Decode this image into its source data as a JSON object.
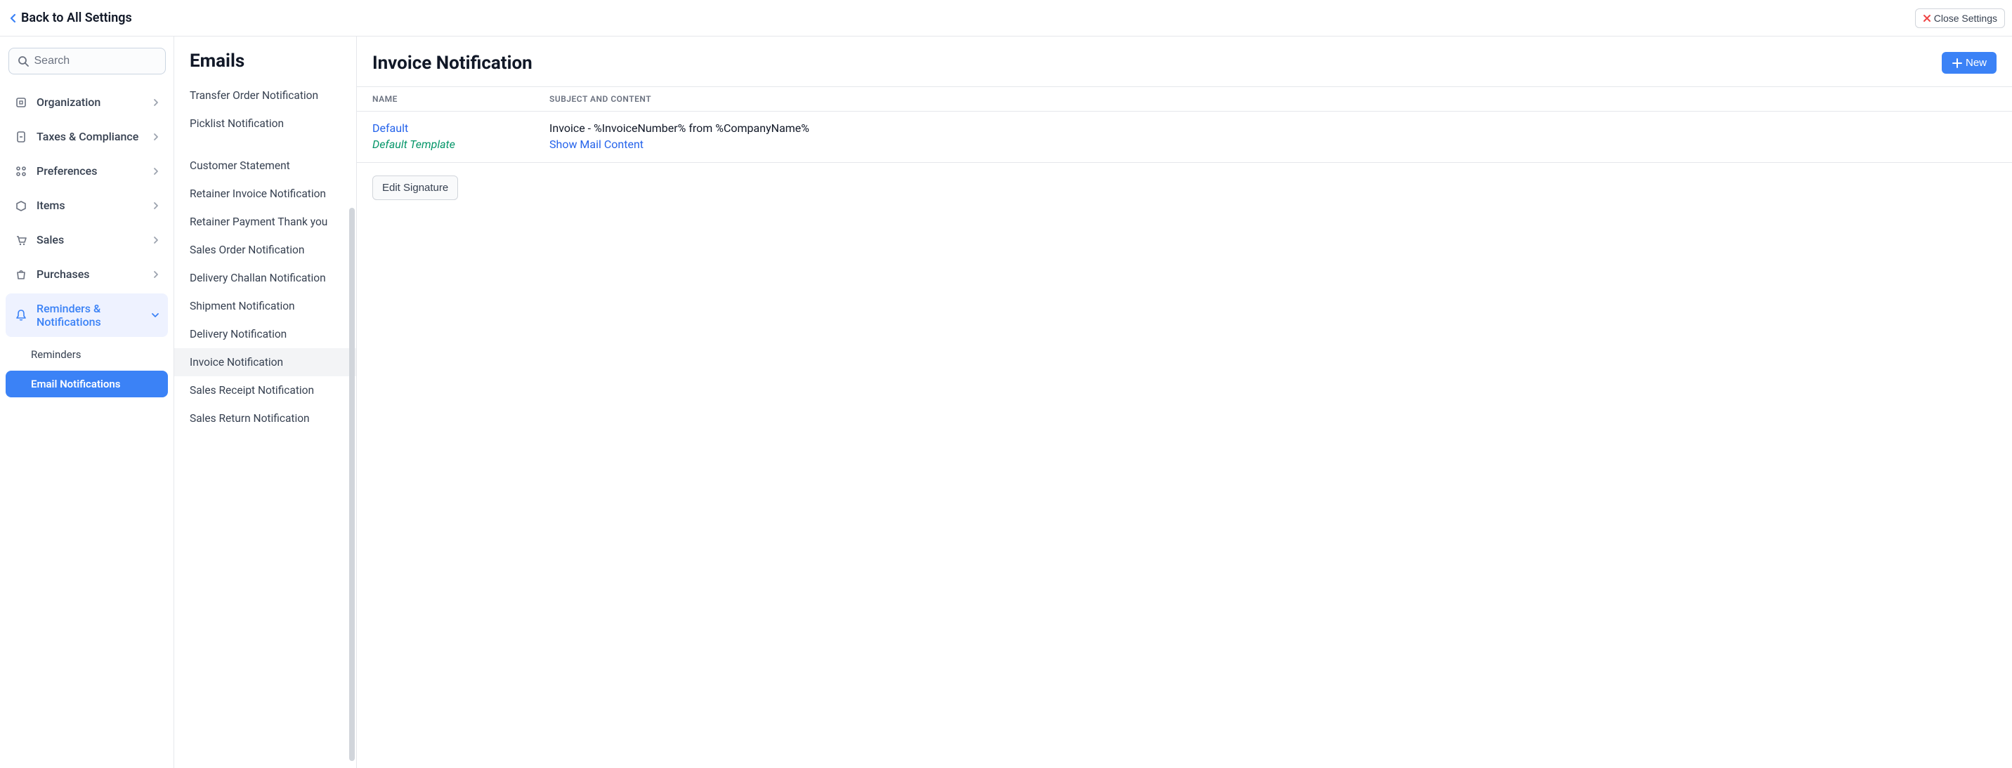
{
  "topbar": {
    "back_label": "Back to All Settings",
    "close_label": "Close Settings"
  },
  "search": {
    "placeholder": "Search"
  },
  "sidebar": {
    "items": [
      {
        "label": "Organization",
        "expandable": true
      },
      {
        "label": "Taxes & Compliance",
        "expandable": true
      },
      {
        "label": "Preferences",
        "expandable": true
      },
      {
        "label": "Items",
        "expandable": true
      },
      {
        "label": "Sales",
        "expandable": true
      },
      {
        "label": "Purchases",
        "expandable": true
      },
      {
        "label": "Reminders & Notifications",
        "expandable": true,
        "active": true
      }
    ],
    "subitems": [
      {
        "label": "Reminders"
      },
      {
        "label": "Email Notifications",
        "selected": true
      }
    ]
  },
  "mid": {
    "title": "Emails",
    "items": [
      {
        "label": "Transfer Order Notification"
      },
      {
        "label": "Picklist Notification"
      },
      {
        "label": "",
        "spacer": true
      },
      {
        "label": "Customer Statement"
      },
      {
        "label": "Retainer Invoice Notification"
      },
      {
        "label": "Retainer Payment Thank you"
      },
      {
        "label": "Sales Order Notification"
      },
      {
        "label": "Delivery Challan Notification"
      },
      {
        "label": "Shipment Notification"
      },
      {
        "label": "Delivery Notification"
      },
      {
        "label": "Invoice Notification",
        "selected": true
      },
      {
        "label": "Sales Receipt Notification"
      },
      {
        "label": "Sales Return Notification"
      }
    ]
  },
  "main": {
    "title": "Invoice Notification",
    "new_label": "New",
    "columns": {
      "name": "NAME",
      "subject": "SUBJECT AND CONTENT"
    },
    "rows": [
      {
        "name": "Default",
        "template_badge": "Default Template",
        "subject": "Invoice - %InvoiceNumber% from %CompanyName%",
        "show_link": "Show Mail Content"
      }
    ],
    "edit_signature_label": "Edit Signature"
  },
  "colors": {
    "accent": "#3b82f6"
  }
}
